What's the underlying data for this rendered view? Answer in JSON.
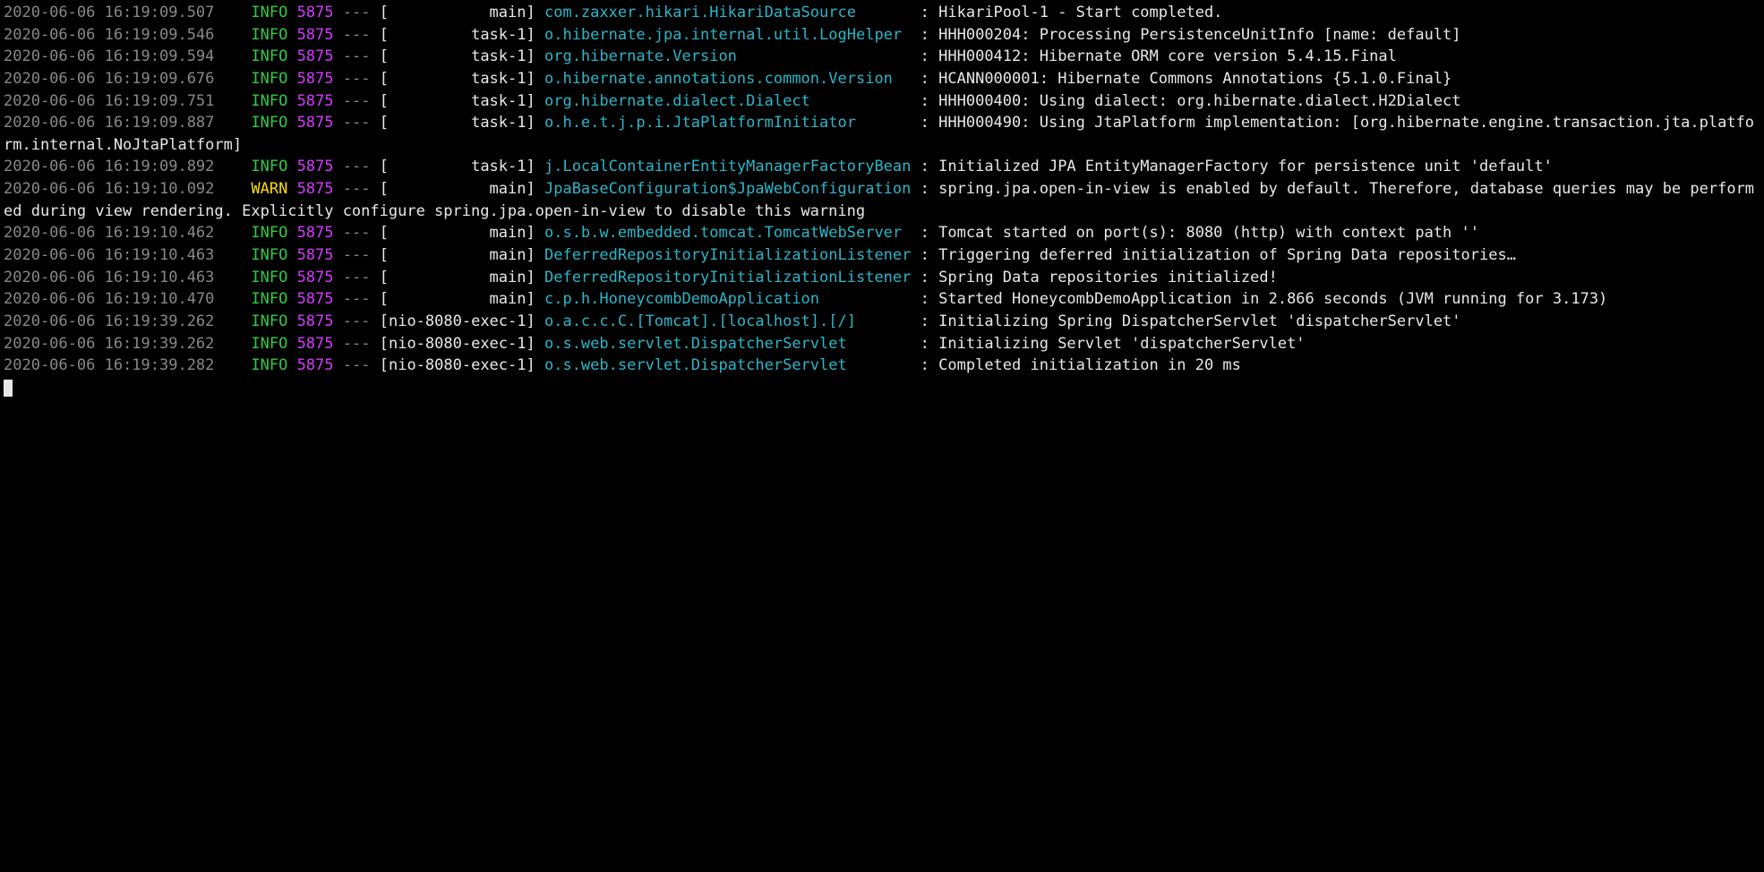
{
  "columns": {
    "timestamp_width": 24,
    "level_width": 5,
    "pid_width": 4,
    "thread_width": 15,
    "logger_width": 40
  },
  "logs": [
    {
      "timestamp": "2020-06-06 16:19:09.507",
      "level": "INFO",
      "pid": "5875",
      "thread": "main",
      "logger": "com.zaxxer.hikari.HikariDataSource",
      "message": "HikariPool-1 - Start completed."
    },
    {
      "timestamp": "2020-06-06 16:19:09.546",
      "level": "INFO",
      "pid": "5875",
      "thread": "task-1",
      "logger": "o.hibernate.jpa.internal.util.LogHelper",
      "message": "HHH000204: Processing PersistenceUnitInfo [name: default]"
    },
    {
      "timestamp": "2020-06-06 16:19:09.594",
      "level": "INFO",
      "pid": "5875",
      "thread": "task-1",
      "logger": "org.hibernate.Version",
      "message": "HHH000412: Hibernate ORM core version 5.4.15.Final"
    },
    {
      "timestamp": "2020-06-06 16:19:09.676",
      "level": "INFO",
      "pid": "5875",
      "thread": "task-1",
      "logger": "o.hibernate.annotations.common.Version",
      "message": "HCANN000001: Hibernate Commons Annotations {5.1.0.Final}"
    },
    {
      "timestamp": "2020-06-06 16:19:09.751",
      "level": "INFO",
      "pid": "5875",
      "thread": "task-1",
      "logger": "org.hibernate.dialect.Dialect",
      "message": "HHH000400: Using dialect: org.hibernate.dialect.H2Dialect"
    },
    {
      "timestamp": "2020-06-06 16:19:09.887",
      "level": "INFO",
      "pid": "5875",
      "thread": "task-1",
      "logger": "o.h.e.t.j.p.i.JtaPlatformInitiator",
      "message": "HHH000490: Using JtaPlatform implementation: [org.hibernate.engine.transaction.jta.platform.internal.NoJtaPlatform]"
    },
    {
      "timestamp": "2020-06-06 16:19:09.892",
      "level": "INFO",
      "pid": "5875",
      "thread": "task-1",
      "logger": "j.LocalContainerEntityManagerFactoryBean",
      "message": "Initialized JPA EntityManagerFactory for persistence unit 'default'"
    },
    {
      "timestamp": "2020-06-06 16:19:10.092",
      "level": "WARN",
      "pid": "5875",
      "thread": "main",
      "logger": "JpaBaseConfiguration$JpaWebConfiguration",
      "message": "spring.jpa.open-in-view is enabled by default. Therefore, database queries may be performed during view rendering. Explicitly configure spring.jpa.open-in-view to disable this warning"
    },
    {
      "timestamp": "2020-06-06 16:19:10.462",
      "level": "INFO",
      "pid": "5875",
      "thread": "main",
      "logger": "o.s.b.w.embedded.tomcat.TomcatWebServer",
      "message": "Tomcat started on port(s): 8080 (http) with context path ''"
    },
    {
      "timestamp": "2020-06-06 16:19:10.463",
      "level": "INFO",
      "pid": "5875",
      "thread": "main",
      "logger": "DeferredRepositoryInitializationListener",
      "message": "Triggering deferred initialization of Spring Data repositories…"
    },
    {
      "timestamp": "2020-06-06 16:19:10.463",
      "level": "INFO",
      "pid": "5875",
      "thread": "main",
      "logger": "DeferredRepositoryInitializationListener",
      "message": "Spring Data repositories initialized!"
    },
    {
      "timestamp": "2020-06-06 16:19:10.470",
      "level": "INFO",
      "pid": "5875",
      "thread": "main",
      "logger": "c.p.h.HoneycombDemoApplication",
      "message": "Started HoneycombDemoApplication in 2.866 seconds (JVM running for 3.173)"
    },
    {
      "timestamp": "2020-06-06 16:19:39.262",
      "level": "INFO",
      "pid": "5875",
      "thread": "nio-8080-exec-1",
      "logger": "o.a.c.c.C.[Tomcat].[localhost].[/]",
      "message": "Initializing Spring DispatcherServlet 'dispatcherServlet'"
    },
    {
      "timestamp": "2020-06-06 16:19:39.262",
      "level": "INFO",
      "pid": "5875",
      "thread": "nio-8080-exec-1",
      "logger": "o.s.web.servlet.DispatcherServlet",
      "message": "Initializing Servlet 'dispatcherServlet'"
    },
    {
      "timestamp": "2020-06-06 16:19:39.282",
      "level": "INFO",
      "pid": "5875",
      "thread": "nio-8080-exec-1",
      "logger": "o.s.web.servlet.DispatcherServlet",
      "message": "Completed initialization in 20 ms"
    }
  ]
}
